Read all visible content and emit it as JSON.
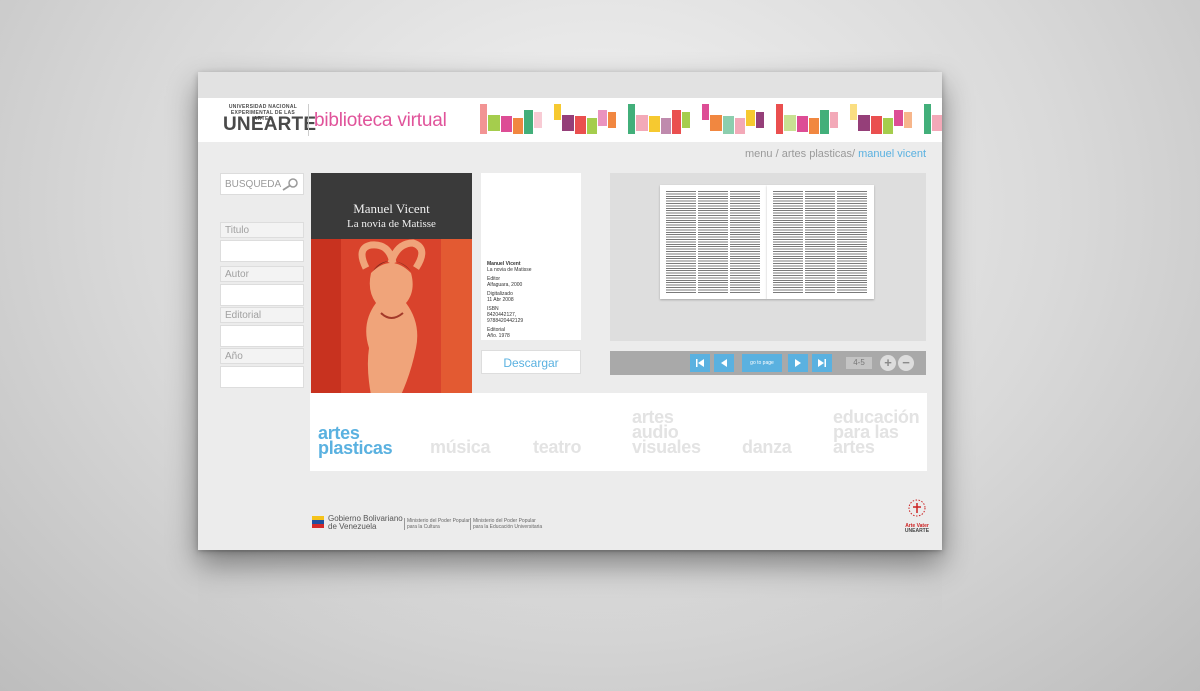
{
  "header": {
    "university_small": "UNIVERSIDAD NACIONAL EXPERIMENTAL DE LAS ARTES",
    "university_big": "UNEARTE",
    "brand": "biblioteca virtual"
  },
  "breadcrumb": {
    "path": "menu / artes plasticas/ ",
    "current": "manuel vicent"
  },
  "sidebar": {
    "search_label": "BUSQUEDA",
    "fields": [
      "Titulo",
      "Autor",
      "Editorial",
      "Año"
    ]
  },
  "book": {
    "cover_author": "Manuel Vicent",
    "cover_title": "La novia de Matisse",
    "info_author": "Manuel Vicent",
    "info_title": "La novia de Matisse",
    "editor_label": "Editor",
    "editor_value": "Alfaguara, 2000",
    "digitalized_label": "Digitalizado",
    "digitalized_value": "11 Abr 2008",
    "isbn_label": "ISBN",
    "isbn_value_1": "8420442127,",
    "isbn_value_2": "9788420442129",
    "editorial_label": "Editorial",
    "year_value": "Año. 1978",
    "download_label": "Descargar"
  },
  "viewer": {
    "goto_label": "go to page",
    "page_number": "4-5",
    "zoom_in": "+",
    "zoom_out": "−"
  },
  "categories": {
    "artes_plasticas_1": "artes",
    "artes_plasticas_2": "plasticas",
    "musica": "música",
    "teatro": "teatro",
    "audiovisuales_1": "artes",
    "audiovisuales_2": "audio",
    "audiovisuales_3": "visuales",
    "danza": "danza",
    "educacion_1": "educación",
    "educacion_2": "para las",
    "educacion_3": "artes"
  },
  "footer": {
    "gov_line1": "Gobierno Bolivariano",
    "gov_line2": "de Venezuela",
    "min1_line1": "Ministerio del Poder Popular",
    "min1_line2": "para la Cultura",
    "min2_line1": "Ministerio del Poder Popular",
    "min2_line2": "para la Educación Universitaria",
    "arte_logo_line1": "Arte Vater",
    "arte_logo_line2": "UNEARTE"
  },
  "colors": {
    "accent_blue": "#5ab1e0",
    "brand_pink": "#e0539a",
    "stripe_palette": [
      "#e83c3c",
      "#f07a2b",
      "#f5c31a",
      "#9bc83a",
      "#2ea66b",
      "#8a2a6a",
      "#d93a8a",
      "#f2a0b0"
    ]
  },
  "icons": {
    "search": "magnifier-icon",
    "first": "first-page-icon",
    "prev": "prev-page-icon",
    "next": "next-page-icon",
    "last": "last-page-icon"
  }
}
